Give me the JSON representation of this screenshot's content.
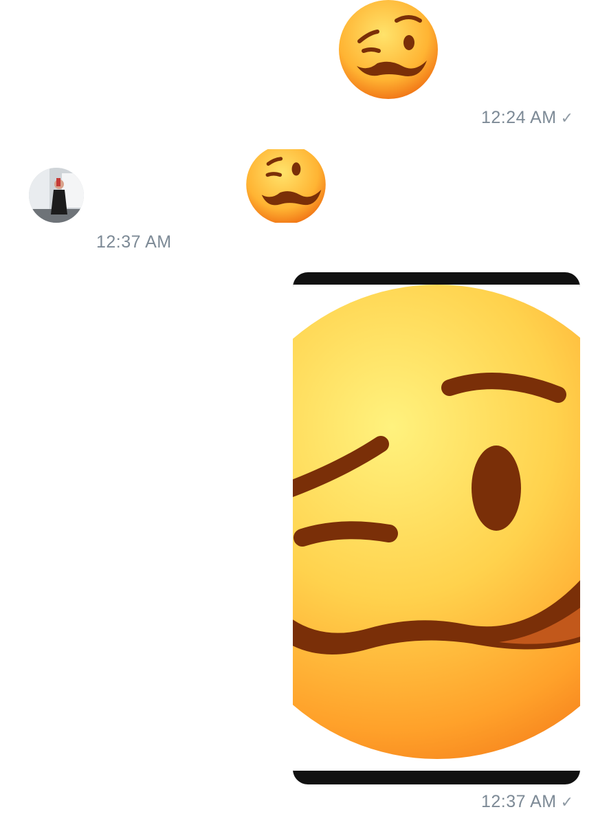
{
  "messages": [
    {
      "direction": "outgoing",
      "type": "emoji",
      "emoji": "woozy-face",
      "time": "12:24 AM",
      "status": "✓"
    },
    {
      "direction": "incoming",
      "type": "emoji",
      "emoji": "woozy-face",
      "time": "12:37 AM",
      "avatar": "contact-avatar"
    },
    {
      "direction": "outgoing",
      "type": "image",
      "image": "woozy-face-closeup",
      "time": "12:37 AM",
      "status": "✓"
    }
  ],
  "colors": {
    "timestamp": "#7d8a96",
    "emoji_light": "#ffe36b",
    "emoji_dark": "#f27a18",
    "feature": "#7a2f08",
    "image_frame": "#111111"
  }
}
